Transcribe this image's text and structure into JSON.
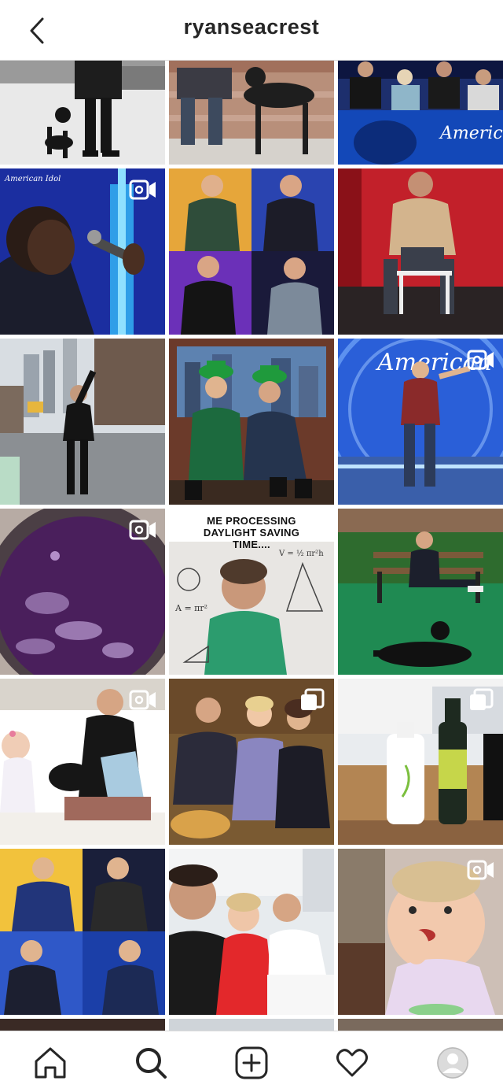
{
  "header": {
    "title": "ryanseacrest",
    "back_icon": "chevron-left-icon"
  },
  "grid": {
    "posts": [
      {
        "row": 0,
        "col": 0,
        "theme": "black-and-white man walking dog"
      },
      {
        "row": 0,
        "col": 1,
        "theme": "man with black labrador on steps"
      },
      {
        "row": 0,
        "col": 2,
        "theme": "judges panel on stage"
      },
      {
        "row": 1,
        "col": 0,
        "theme": "singer with microphone",
        "brand": "American Idol",
        "badge": "igtv-icon"
      },
      {
        "row": 1,
        "col": 1,
        "theme": "four-photo host collage"
      },
      {
        "row": 1,
        "col": 2,
        "theme": "man on stool red backdrop"
      },
      {
        "row": 2,
        "col": 0,
        "theme": "man in city street"
      },
      {
        "row": 2,
        "col": 1,
        "theme": "two hosts in green hats"
      },
      {
        "row": 2,
        "col": 2,
        "theme": "contestant on idol stage",
        "badge": "igtv-icon"
      },
      {
        "row": 3,
        "col": 0,
        "theme": "purple liquid in pot",
        "badge": "igtv-icon"
      },
      {
        "row": 3,
        "col": 1,
        "theme": "meme with math formulas",
        "caption": "ME PROCESSING DAYLIGHT SAVING TIME...."
      },
      {
        "row": 3,
        "col": 2,
        "theme": "man on bench with dog"
      },
      {
        "row": 4,
        "col": 0,
        "theme": "man reading to child",
        "badge": "igtv-icon"
      },
      {
        "row": 4,
        "col": 1,
        "theme": "family selfie",
        "badge": "carousel-icon"
      },
      {
        "row": 4,
        "col": 2,
        "theme": "olive oil bottles",
        "badge": "carousel-icon"
      },
      {
        "row": 5,
        "col": 0,
        "theme": "four-photo host collage"
      },
      {
        "row": 5,
        "col": 1,
        "theme": "family group selfie"
      },
      {
        "row": 5,
        "col": 2,
        "theme": "toddler eating",
        "badge": "igtv-icon"
      }
    ]
  },
  "bottom_nav": {
    "items": [
      {
        "name": "home",
        "icon": "home-icon"
      },
      {
        "name": "search",
        "icon": "search-icon"
      },
      {
        "name": "new-post",
        "icon": "plus-square-icon"
      },
      {
        "name": "activity",
        "icon": "heart-icon"
      },
      {
        "name": "profile",
        "icon": "avatar-icon"
      }
    ]
  },
  "colors": {
    "text": "#262626",
    "border": "#dbdbdb",
    "idol_blue": "#1f3fa8",
    "idol_red": "#b3121b",
    "lawn_green": "#1f8a52"
  }
}
